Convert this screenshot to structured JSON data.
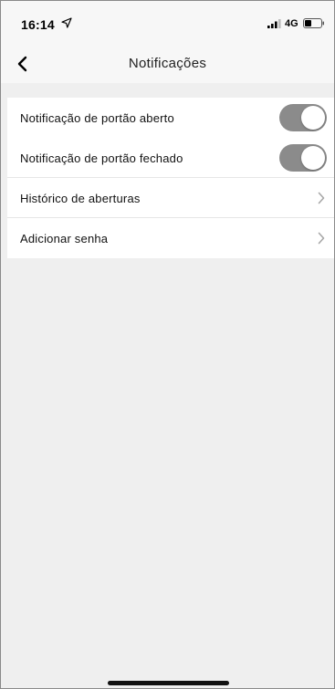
{
  "status_bar": {
    "time": "16:14",
    "network": "4G",
    "location_icon": "location-arrow-icon",
    "signal_icon": "cellular-signal-icon",
    "battery_icon": "battery-icon"
  },
  "nav": {
    "title": "Notificações",
    "back_icon": "chevron-left-icon"
  },
  "settings": {
    "items": [
      {
        "label": "Notificação de portão aberto",
        "control": "toggle",
        "enabled": true
      },
      {
        "label": "Notificação de portão fechado",
        "control": "toggle",
        "enabled": true
      },
      {
        "label": "Histórico de aberturas",
        "control": "disclosure"
      },
      {
        "label": "Adicionar senha",
        "control": "disclosure"
      }
    ]
  },
  "colors": {
    "toggle_track": "#8b8b8b",
    "background": "#efefef",
    "nav_background": "#f7f7f7"
  }
}
